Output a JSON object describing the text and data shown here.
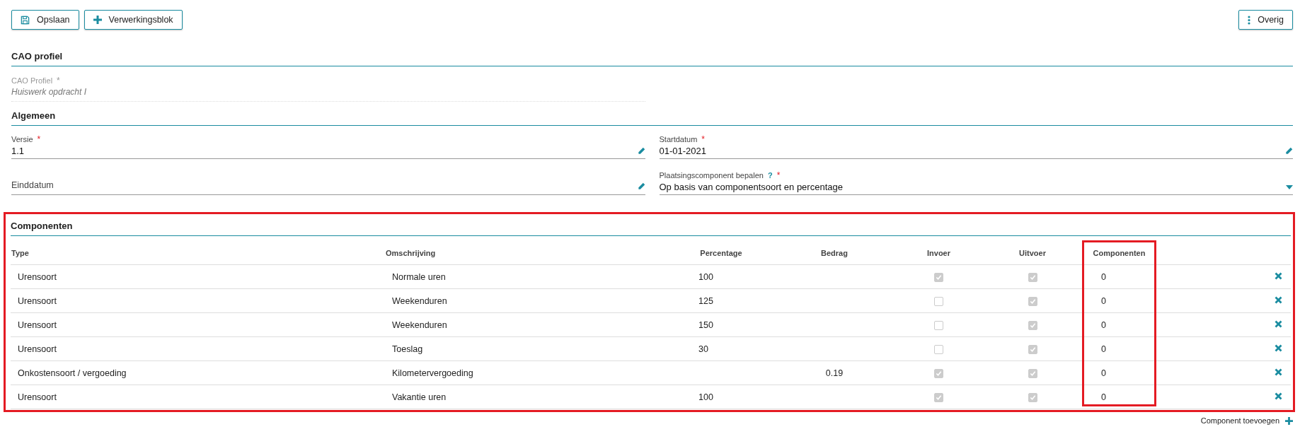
{
  "toolbar": {
    "buttons": [
      {
        "label": "Opslaan"
      },
      {
        "label": "Verwerkingsblok"
      }
    ],
    "menu_button": {
      "label": "Overig"
    }
  },
  "cao_profiel": {
    "title": "CAO profiel",
    "fields": [
      {
        "label": "CAO Profiel",
        "required_mark": "*",
        "readonly": true,
        "value": "Huiswerk opdracht I"
      }
    ]
  },
  "algemeen": {
    "title": "Algemeen",
    "fields": [
      {
        "kind": "text",
        "label": "Versie",
        "required_mark": "*",
        "value": "1.1"
      },
      {
        "kind": "text",
        "label": "Einddatum"
      },
      {
        "kind": "text",
        "label": "Startdatum",
        "required_mark": "*",
        "value": "01-01-2021"
      },
      {
        "kind": "select",
        "label": "Plaatsingscomponent bepalen",
        "help": "?",
        "required_mark": "*",
        "value": "Op basis van componentsoort en percentage"
      }
    ]
  },
  "componenten": {
    "title": "Componenten",
    "highlighted": true,
    "editable": false,
    "columns": [
      {
        "label": "Type",
        "highlighted": false
      },
      {
        "label": "Omschrijving",
        "highlighted": false
      },
      {
        "label": "Percentage",
        "highlighted": false
      },
      {
        "label": "Bedrag",
        "highlighted": false
      },
      {
        "label": "Invoer",
        "highlighted": false
      },
      {
        "label": "Uitvoer",
        "highlighted": false
      },
      {
        "label": "Componenten",
        "highlighted": true
      }
    ],
    "rows": [
      {
        "type": "Urensoort",
        "omschrijving": "Normale uren",
        "percentage": "100",
        "invoer": true,
        "uitvoer": true,
        "componenten": "0"
      },
      {
        "type": "Urensoort",
        "omschrijving": "Weekenduren",
        "percentage": "125",
        "invoer": false,
        "uitvoer": true,
        "componenten": "0"
      },
      {
        "type": "Urensoort",
        "omschrijving": "Weekenduren",
        "percentage": "150",
        "invoer": false,
        "uitvoer": true,
        "componenten": "0"
      },
      {
        "type": "Urensoort",
        "omschrijving": "Toeslag",
        "percentage": "30",
        "invoer": false,
        "uitvoer": true,
        "componenten": "0"
      },
      {
        "type": "Onkostensoort / vergoeding",
        "omschrijving": "Kilometervergoeding",
        "bedrag": "0.19",
        "invoer": true,
        "uitvoer": true,
        "componenten": "0"
      },
      {
        "type": "Urensoort",
        "omschrijving": "Vakantie uren",
        "percentage": "100",
        "invoer": true,
        "uitvoer": true,
        "componenten": "0"
      }
    ],
    "add_link": "Component toevoegen"
  }
}
